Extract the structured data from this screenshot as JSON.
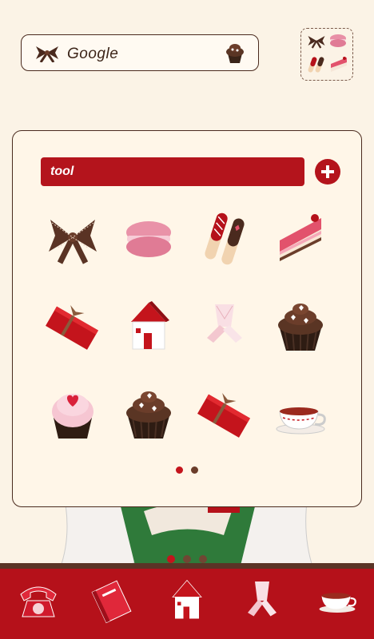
{
  "search_widget": {
    "label": "Google"
  },
  "folder": {
    "name": "tool"
  },
  "apps": [
    {
      "icon": "ribbon-bow-icon"
    },
    {
      "icon": "pink-macaron-icon"
    },
    {
      "icon": "chocolate-sticks-icon"
    },
    {
      "icon": "strawberry-cake-slice-icon"
    },
    {
      "icon": "red-gift-box-icon"
    },
    {
      "icon": "red-roof-house-icon"
    },
    {
      "icon": "pink-ribbon-icon"
    },
    {
      "icon": "chocolate-cupcake-icon"
    },
    {
      "icon": "pink-heart-cupcake-icon"
    },
    {
      "icon": "chocolate-cupcake-icon"
    },
    {
      "icon": "red-gift-box-icon"
    },
    {
      "icon": "teacup-icon"
    }
  ],
  "folder_pages": {
    "count": 2,
    "active": 0
  },
  "home_pages": {
    "count": 3,
    "active": 0
  },
  "dock": [
    {
      "icon": "red-telephone-icon"
    },
    {
      "icon": "red-book-icon"
    },
    {
      "icon": "red-roof-house-icon"
    },
    {
      "icon": "pink-ribbon-icon"
    },
    {
      "icon": "teacup-icon"
    }
  ],
  "colors": {
    "accent": "#b4141c",
    "brown": "#4a2a1e",
    "background": "#fbf3e6"
  }
}
